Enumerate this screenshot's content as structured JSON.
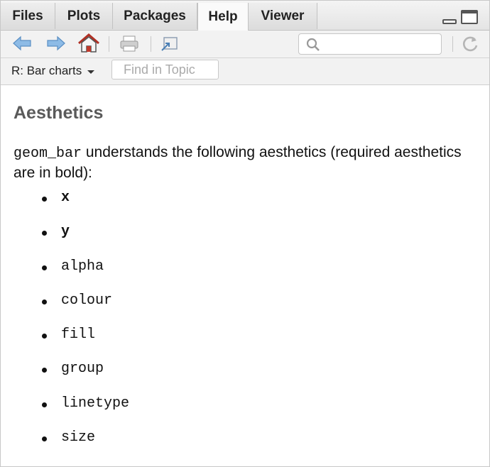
{
  "tabs": [
    {
      "label": "Files",
      "active": false
    },
    {
      "label": "Plots",
      "active": false
    },
    {
      "label": "Packages",
      "active": false
    },
    {
      "label": "Help",
      "active": true
    },
    {
      "label": "Viewer",
      "active": false
    }
  ],
  "toolbar": {
    "icons": [
      "back-arrow-icon",
      "forward-arrow-icon",
      "home-icon",
      "print-icon",
      "show-in-window-icon",
      "refresh-icon"
    ],
    "search_value": ""
  },
  "topic": {
    "selected": "R: Bar charts",
    "find_placeholder": "Find in Topic"
  },
  "doc": {
    "heading": "Aesthetics",
    "intro_code": "geom_bar",
    "intro_text": " understands the following aesthetics (required aesthetics are in bold):",
    "aesthetics": [
      {
        "name": "x",
        "required": true
      },
      {
        "name": "y",
        "required": true
      },
      {
        "name": "alpha",
        "required": false
      },
      {
        "name": "colour",
        "required": false
      },
      {
        "name": "fill",
        "required": false
      },
      {
        "name": "group",
        "required": false
      },
      {
        "name": "linetype",
        "required": false
      },
      {
        "name": "size",
        "required": false
      }
    ]
  },
  "colors": {
    "arrow_blue": "#5b9bd5",
    "home_red": "#c0392b",
    "heading_gray": "#5a5a5a"
  }
}
